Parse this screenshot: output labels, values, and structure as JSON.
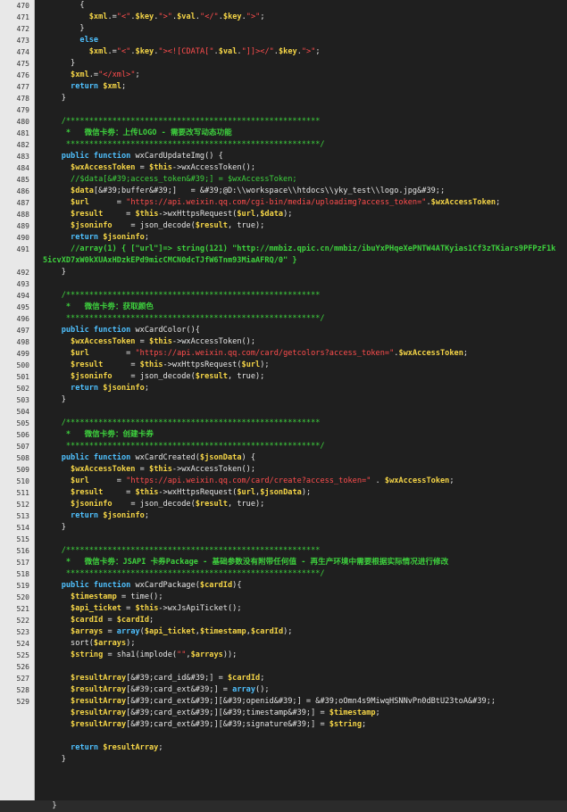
{
  "editor": {
    "lines": [
      {
        "n": "470",
        "segs": [
          [
            "o",
            "        {"
          ]
        ]
      },
      {
        "n": "471",
        "segs": [
          [
            "v",
            "          $xml"
          ],
          [
            "o",
            ".="
          ],
          [
            "s",
            "\"<\""
          ],
          [
            "o",
            "."
          ],
          [
            "v",
            "$key"
          ],
          [
            "o",
            "."
          ],
          [
            "s",
            "\">\""
          ],
          [
            "o",
            "."
          ],
          [
            "v",
            "$val"
          ],
          [
            "o",
            "."
          ],
          [
            "s",
            "\"</\""
          ],
          [
            "o",
            "."
          ],
          [
            "v",
            "$key"
          ],
          [
            "o",
            "."
          ],
          [
            "s",
            "\">\""
          ],
          [
            "o",
            ";"
          ]
        ]
      },
      {
        "n": "472",
        "segs": [
          [
            "o",
            "        }"
          ]
        ]
      },
      {
        "n": "473",
        "segs": [
          [
            "k",
            "        else"
          ]
        ]
      },
      {
        "n": "474",
        "segs": [
          [
            "v",
            "          $xml"
          ],
          [
            "o",
            ".="
          ],
          [
            "s",
            "\"<\""
          ],
          [
            "o",
            "."
          ],
          [
            "v",
            "$key"
          ],
          [
            "o",
            "."
          ],
          [
            "s",
            "\"><![CDATA[\""
          ],
          [
            "o",
            "."
          ],
          [
            "v",
            "$val"
          ],
          [
            "o",
            "."
          ],
          [
            "s",
            "\"]]></\""
          ],
          [
            "o",
            "."
          ],
          [
            "v",
            "$key"
          ],
          [
            "o",
            "."
          ],
          [
            "s",
            "\">\""
          ],
          [
            "o",
            ";"
          ]
        ]
      },
      {
        "n": "475",
        "segs": [
          [
            "o",
            "      }"
          ]
        ]
      },
      {
        "n": "476",
        "segs": [
          [
            "v",
            "      $xml"
          ],
          [
            "o",
            ".="
          ],
          [
            "s",
            "\"</xml>\""
          ],
          [
            "o",
            ";"
          ]
        ]
      },
      {
        "n": "477",
        "segs": [
          [
            "k",
            "      return "
          ],
          [
            "v",
            "$xml"
          ],
          [
            "o",
            ";"
          ]
        ]
      },
      {
        "n": "478",
        "segs": [
          [
            "o",
            "    }"
          ]
        ]
      },
      {
        "n": "479",
        "segs": [
          [
            "o",
            ""
          ]
        ]
      },
      {
        "n": "480",
        "segs": [
          [
            "c",
            "    /*******************************************************"
          ]
        ]
      },
      {
        "n": "481",
        "segs": [
          [
            "cw",
            "     *   微信卡劵：上传LOGO - 需要改写动态功能"
          ]
        ]
      },
      {
        "n": "482",
        "segs": [
          [
            "c",
            "     *******************************************************/"
          ]
        ]
      },
      {
        "n": "483",
        "segs": [
          [
            "k",
            "    public function "
          ],
          [
            "o",
            "wxCardUpdateImg() {"
          ]
        ]
      },
      {
        "n": "484",
        "segs": [
          [
            "v",
            "      $wxAccessToken "
          ],
          [
            "o",
            "= "
          ],
          [
            "v",
            "$this"
          ],
          [
            "o",
            "->wxAccessToken();"
          ]
        ]
      },
      {
        "n": "485",
        "segs": [
          [
            "c",
            "      //$data[&#39;access_token&#39;] = $wxAccessToken;"
          ]
        ]
      },
      {
        "n": "486",
        "segs": [
          [
            "v",
            "      $data"
          ],
          [
            "o",
            "[&#39;buffer&#39;]   = &#39;@D:\\\\workspace\\\\htdocs\\\\yky_test\\\\logo.jpg&#39;;"
          ]
        ]
      },
      {
        "n": "487",
        "segs": [
          [
            "v",
            "      $url      "
          ],
          [
            "o",
            "= "
          ],
          [
            "s",
            "\"https://api.weixin.qq.com/cgi-bin/media/uploadimg?access_token=\""
          ],
          [
            "o",
            "."
          ],
          [
            "v",
            "$wxAccessToken"
          ],
          [
            "o",
            ";"
          ]
        ]
      },
      {
        "n": "488",
        "segs": [
          [
            "v",
            "      $result     "
          ],
          [
            "o",
            "= "
          ],
          [
            "v",
            "$this"
          ],
          [
            "o",
            "->wxHttpsRequest("
          ],
          [
            "v",
            "$url"
          ],
          [
            "o",
            ","
          ],
          [
            "v",
            "$data"
          ],
          [
            "o",
            ");"
          ]
        ]
      },
      {
        "n": "489",
        "segs": [
          [
            "v",
            "      $jsoninfo    "
          ],
          [
            "o",
            "= json_decode("
          ],
          [
            "v",
            "$result"
          ],
          [
            "o",
            ", true);"
          ]
        ]
      },
      {
        "n": "490",
        "segs": [
          [
            "k",
            "      return "
          ],
          [
            "v",
            "$jsoninfo"
          ],
          [
            "o",
            ";"
          ]
        ]
      },
      {
        "n": "491",
        "segs": [
          [
            "cw",
            "      //array(1) { [\"url\"]=> string(121) \"http://mmbiz.qpic.cn/mmbiz/ibuYxPHqeXePNTW4ATKyias1Cf3zTKiars9PFPzF1k"
          ]
        ]
      },
      {
        "n": "",
        "segs": [
          [
            "cw",
            "5icvXD7xW0kXUAxHDzkEPd9micCMCN0dcTJfW6Tnm93MiaAFRQ/0\" }"
          ]
        ],
        "wrap": true
      },
      {
        "n": "492",
        "segs": [
          [
            "o",
            "    }"
          ]
        ]
      },
      {
        "n": "493",
        "segs": [
          [
            "o",
            ""
          ]
        ]
      },
      {
        "n": "494",
        "segs": [
          [
            "c",
            "    /*******************************************************"
          ]
        ]
      },
      {
        "n": "495",
        "segs": [
          [
            "cw",
            "     *   微信卡劵：获取颜色"
          ]
        ]
      },
      {
        "n": "496",
        "segs": [
          [
            "c",
            "     *******************************************************/"
          ]
        ]
      },
      {
        "n": "497",
        "segs": [
          [
            "k",
            "    public function "
          ],
          [
            "o",
            "wxCardColor(){"
          ]
        ]
      },
      {
        "n": "498",
        "segs": [
          [
            "v",
            "      $wxAccessToken "
          ],
          [
            "o",
            "= "
          ],
          [
            "v",
            "$this"
          ],
          [
            "o",
            "->wxAccessToken();"
          ]
        ]
      },
      {
        "n": "499",
        "segs": [
          [
            "v",
            "      $url        "
          ],
          [
            "o",
            "= "
          ],
          [
            "s",
            "\"https://api.weixin.qq.com/card/getcolors?access_token=\""
          ],
          [
            "o",
            "."
          ],
          [
            "v",
            "$wxAccessToken"
          ],
          [
            "o",
            ";"
          ]
        ]
      },
      {
        "n": "500",
        "segs": [
          [
            "v",
            "      $result      "
          ],
          [
            "o",
            "= "
          ],
          [
            "v",
            "$this"
          ],
          [
            "o",
            "->wxHttpsRequest("
          ],
          [
            "v",
            "$url"
          ],
          [
            "o",
            ");"
          ]
        ]
      },
      {
        "n": "501",
        "segs": [
          [
            "v",
            "      $jsoninfo    "
          ],
          [
            "o",
            "= json_decode("
          ],
          [
            "v",
            "$result"
          ],
          [
            "o",
            ", true);"
          ]
        ]
      },
      {
        "n": "502",
        "segs": [
          [
            "k",
            "      return "
          ],
          [
            "v",
            "$jsoninfo"
          ],
          [
            "o",
            ";"
          ]
        ]
      },
      {
        "n": "503",
        "segs": [
          [
            "o",
            "    }"
          ]
        ]
      },
      {
        "n": "504",
        "segs": [
          [
            "o",
            ""
          ]
        ]
      },
      {
        "n": "505",
        "segs": [
          [
            "c",
            "    /*******************************************************"
          ]
        ]
      },
      {
        "n": "506",
        "segs": [
          [
            "cw",
            "     *   微信卡劵：创建卡券"
          ]
        ]
      },
      {
        "n": "507",
        "segs": [
          [
            "c",
            "     *******************************************************/"
          ]
        ]
      },
      {
        "n": "508",
        "segs": [
          [
            "k",
            "    public function "
          ],
          [
            "o",
            "wxCardCreated("
          ],
          [
            "v",
            "$jsonData"
          ],
          [
            "o",
            ") {"
          ]
        ]
      },
      {
        "n": "509",
        "segs": [
          [
            "v",
            "      $wxAccessToken "
          ],
          [
            "o",
            "= "
          ],
          [
            "v",
            "$this"
          ],
          [
            "o",
            "->wxAccessToken();"
          ]
        ]
      },
      {
        "n": "510",
        "segs": [
          [
            "v",
            "      $url      "
          ],
          [
            "o",
            "= "
          ],
          [
            "s",
            "\"https://api.weixin.qq.com/card/create?access_token=\""
          ],
          [
            "o",
            " . "
          ],
          [
            "v",
            "$wxAccessToken"
          ],
          [
            "o",
            ";"
          ]
        ]
      },
      {
        "n": "511",
        "segs": [
          [
            "v",
            "      $result     "
          ],
          [
            "o",
            "= "
          ],
          [
            "v",
            "$this"
          ],
          [
            "o",
            "->wxHttpsRequest("
          ],
          [
            "v",
            "$url"
          ],
          [
            "o",
            ","
          ],
          [
            "v",
            "$jsonData"
          ],
          [
            "o",
            ");"
          ]
        ]
      },
      {
        "n": "512",
        "segs": [
          [
            "v",
            "      $jsoninfo    "
          ],
          [
            "o",
            "= json_decode("
          ],
          [
            "v",
            "$result"
          ],
          [
            "o",
            ", true);"
          ]
        ]
      },
      {
        "n": "513",
        "segs": [
          [
            "k",
            "      return "
          ],
          [
            "v",
            "$jsoninfo"
          ],
          [
            "o",
            ";"
          ]
        ]
      },
      {
        "n": "514",
        "segs": [
          [
            "o",
            "    }"
          ]
        ]
      },
      {
        "n": "515",
        "segs": [
          [
            "o",
            ""
          ]
        ]
      },
      {
        "n": "516",
        "segs": [
          [
            "c",
            "    /*******************************************************"
          ]
        ]
      },
      {
        "n": "517",
        "segs": [
          [
            "cw",
            "     *   微信卡劵：JSAPI 卡券Package - 基础参数没有附带任何值 - 再生产环境中需要根据实际情况进行修改"
          ]
        ]
      },
      {
        "n": "518",
        "segs": [
          [
            "c",
            "     *******************************************************/"
          ]
        ]
      },
      {
        "n": "519",
        "segs": [
          [
            "k",
            "    public function "
          ],
          [
            "o",
            "wxCardPackage("
          ],
          [
            "v",
            "$cardId"
          ],
          [
            "o",
            "){"
          ]
        ]
      },
      {
        "n": "520",
        "segs": [
          [
            "v",
            "      $timestamp "
          ],
          [
            "o",
            "= time();"
          ]
        ]
      },
      {
        "n": "521",
        "segs": [
          [
            "v",
            "      $api_ticket "
          ],
          [
            "o",
            "= "
          ],
          [
            "v",
            "$this"
          ],
          [
            "o",
            "->wxJsApiTicket();"
          ]
        ]
      },
      {
        "n": "522",
        "segs": [
          [
            "v",
            "      $cardId "
          ],
          [
            "o",
            "= "
          ],
          [
            "v",
            "$cardId"
          ],
          [
            "o",
            ";"
          ]
        ]
      },
      {
        "n": "523",
        "segs": [
          [
            "v",
            "      $arrays "
          ],
          [
            "o",
            "= "
          ],
          [
            "k",
            "array"
          ],
          [
            "o",
            "("
          ],
          [
            "v",
            "$api_ticket"
          ],
          [
            "o",
            ","
          ],
          [
            "v",
            "$timestamp"
          ],
          [
            "o",
            ","
          ],
          [
            "v",
            "$cardId"
          ],
          [
            "o",
            ");"
          ]
        ]
      },
      {
        "n": "524",
        "segs": [
          [
            "o",
            "      sort("
          ],
          [
            "v",
            "$arrays"
          ],
          [
            "o",
            ");"
          ]
        ]
      },
      {
        "n": "525",
        "segs": [
          [
            "v",
            "      $string "
          ],
          [
            "o",
            "= sha1(implode("
          ],
          [
            "s",
            "\"\""
          ],
          [
            "o",
            ","
          ],
          [
            "v",
            "$arrays"
          ],
          [
            "o",
            "));"
          ]
        ]
      },
      {
        "n": "526",
        "segs": [
          [
            "o",
            ""
          ]
        ]
      },
      {
        "n": "527",
        "segs": [
          [
            "v",
            "      $resultArray"
          ],
          [
            "o",
            "[&#39;card_id&#39;] = "
          ],
          [
            "v",
            "$cardId"
          ],
          [
            "o",
            ";"
          ]
        ]
      },
      {
        "n": "528",
        "segs": [
          [
            "v",
            "      $resultArray"
          ],
          [
            "o",
            "[&#39;card_ext&#39;] = "
          ],
          [
            "k",
            "array"
          ],
          [
            "o",
            "();"
          ]
        ]
      },
      {
        "n": "529",
        "segs": [
          [
            "v",
            "      $resultArray"
          ],
          [
            "o",
            "[&#39;card_ext&#39;][&#39;openid&#39;] = &#39;oOmn4s9MiwqHSNNvPn0dBtU23toA&#39;;"
          ]
        ]
      },
      {
        "n": "",
        "segs": [
          [
            "v",
            "      $resultArray"
          ],
          [
            "o",
            "[&#39;card_ext&#39;][&#39;timestamp&#39;] = "
          ],
          [
            "v",
            "$timestamp"
          ],
          [
            "o",
            ";"
          ]
        ]
      },
      {
        "n": "",
        "segs": [
          [
            "v",
            "      $resultArray"
          ],
          [
            "o",
            "[&#39;card_ext&#39;][&#39;signature&#39;] = "
          ],
          [
            "v",
            "$string"
          ],
          [
            "o",
            ";"
          ]
        ]
      },
      {
        "n": "",
        "segs": [
          [
            "o",
            ""
          ]
        ]
      },
      {
        "n": "",
        "segs": [
          [
            "k",
            "      return "
          ],
          [
            "v",
            "$resultArray"
          ],
          [
            "o",
            ";"
          ]
        ]
      },
      {
        "n": "",
        "segs": [
          [
            "o",
            "    }"
          ]
        ]
      },
      {
        "n": "",
        "segs": [
          [
            "o",
            ""
          ]
        ]
      },
      {
        "n": "",
        "segs": [
          [
            "o",
            ""
          ]
        ]
      },
      {
        "n": "",
        "segs": [
          [
            "o",
            ""
          ]
        ]
      },
      {
        "n": "",
        "segs": [
          [
            "o",
            "  }"
          ]
        ]
      }
    ]
  }
}
